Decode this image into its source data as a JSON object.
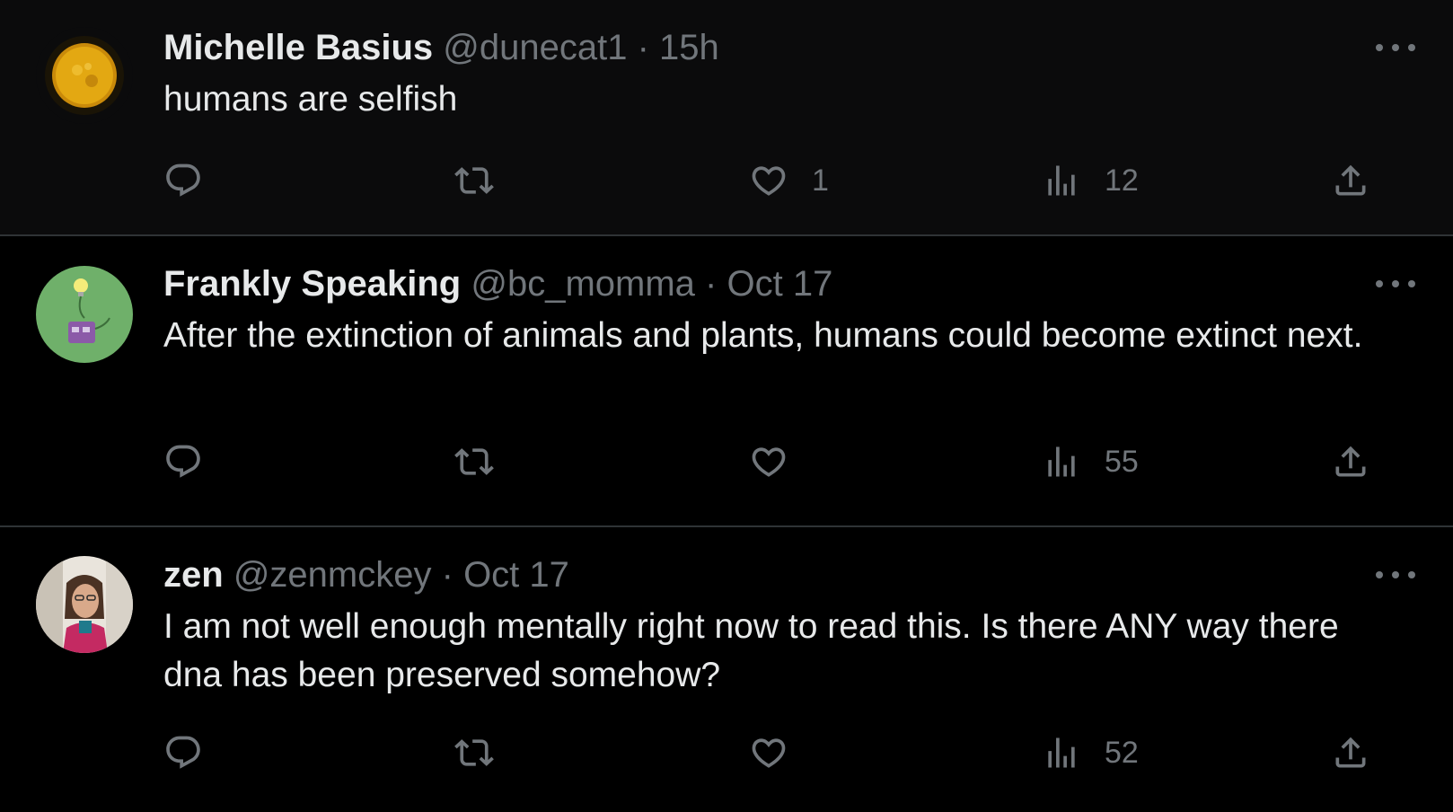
{
  "tweets": [
    {
      "name": "Michelle Basius",
      "handle": "@dunecat1",
      "separator": "·",
      "time": "15h",
      "text": "humans are selfish",
      "replies": "",
      "retweets": "",
      "likes": "1",
      "views": "12",
      "avatar_icon": "sun-avatar"
    },
    {
      "name": "Frankly Speaking",
      "handle": "@bc_momma",
      "separator": "·",
      "time": "Oct 17",
      "text": "After the extinction of animals and plants, humans could become extinct next.",
      "replies": "",
      "retweets": "",
      "likes": "",
      "views": "55",
      "avatar_icon": "lightbulb-cartoon-avatar"
    },
    {
      "name": "zen",
      "handle": "@zenmckey",
      "separator": "·",
      "time": "Oct 17",
      "text": "I am not well enough mentally right now to read this. Is there ANY way there dna has been preserved somehow?",
      "replies": "",
      "retweets": "",
      "likes": "",
      "views": "52",
      "avatar_icon": "person-photo-avatar"
    }
  ],
  "colors": {
    "background": "#000000",
    "text_primary": "#e7e9ea",
    "text_secondary": "#71767b",
    "divider": "#2f3336"
  },
  "icons": [
    "reply-icon",
    "retweet-icon",
    "like-icon",
    "views-icon",
    "share-icon",
    "more-icon"
  ]
}
